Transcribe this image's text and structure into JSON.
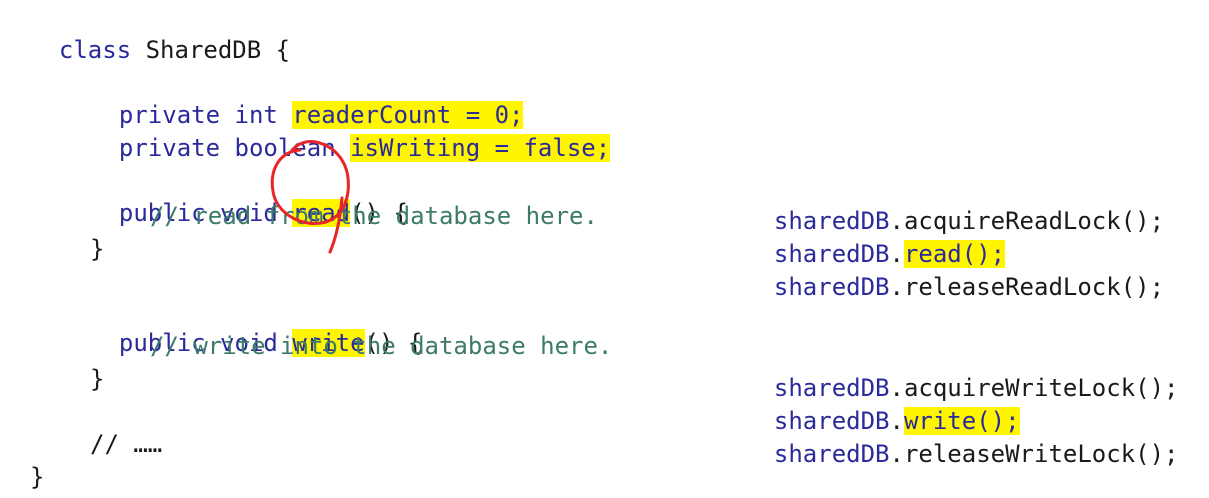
{
  "left_code": {
    "class_decl": {
      "kw": "class",
      "name": " SharedDB ",
      "brace": "{"
    },
    "field1": {
      "mods": "private int ",
      "hl": "readerCount = 0;"
    },
    "field2": {
      "mods": "private boolean ",
      "hl": "isWriting = false;"
    },
    "read_method": {
      "mods": "public void ",
      "name": "read",
      "rest": "() {"
    },
    "read_comment": "// read from the database here.",
    "read_close": "}",
    "write_method": {
      "mods": "public void ",
      "name": "write",
      "rest": "() {"
    },
    "write_comment": "// write into the database here.",
    "write_close": "}",
    "ellipsis_comment": "// ……",
    "class_close": "}"
  },
  "right_code": {
    "read_block": [
      {
        "obj": "sharedDB",
        "dot": ".",
        "call": "acquireReadLock();",
        "highlight": false
      },
      {
        "obj": "sharedDB",
        "dot": ".",
        "call": "read();",
        "highlight": true
      },
      {
        "obj": "sharedDB",
        "dot": ".",
        "call": "releaseReadLock();",
        "highlight": false
      }
    ],
    "write_block": [
      {
        "obj": "sharedDB",
        "dot": ".",
        "call": "acquireWriteLock();",
        "highlight": false
      },
      {
        "obj": "sharedDB",
        "dot": ".",
        "call": "write();",
        "highlight": true
      },
      {
        "obj": "sharedDB",
        "dot": ".",
        "call": "releaseWriteLock();",
        "highlight": false
      }
    ]
  },
  "colors": {
    "highlight": "#fff500",
    "keyword": "#2a2a9a",
    "comment": "#3d7a6a",
    "annotation": "#e8262a"
  }
}
